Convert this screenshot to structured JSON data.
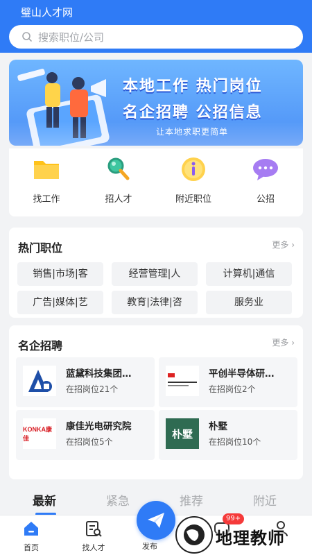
{
  "header": {
    "app_title": "璧山人才网",
    "search_placeholder": "搜索职位/公司"
  },
  "banner": {
    "line1": "本地工作  热门岗位",
    "line2": "名企招聘  公招信息",
    "sub": "让本地求职更简单"
  },
  "quick_links": [
    {
      "label": "找工作",
      "icon": "folder-icon"
    },
    {
      "label": "招人才",
      "icon": "magnifier-icon"
    },
    {
      "label": "附近职位",
      "icon": "info-icon"
    },
    {
      "label": "公招",
      "icon": "chat-bubble-icon"
    }
  ],
  "hot_jobs": {
    "title": "热门职位",
    "more": "更多",
    "tags": [
      "销售|市场|客",
      "经营管理|人",
      "计算机|通信",
      "广告|媒体|艺",
      "教育|法律|咨",
      "服务业"
    ]
  },
  "famous_companies": {
    "title": "名企招聘",
    "more": "更多",
    "items": [
      {
        "name": "蓝黛科技集团…",
        "jobs": "在招岗位21个"
      },
      {
        "name": "平创半导体研…",
        "jobs": "在招岗位2个"
      },
      {
        "name": "康佳光电研究院",
        "jobs": "在招岗位5个",
        "logo_text": "KONKA康佳"
      },
      {
        "name": "朴墅",
        "jobs": "在招岗位10个",
        "logo_text": "朴墅"
      }
    ]
  },
  "feed_tabs": [
    "最新",
    "紧急",
    "推荐",
    "附近"
  ],
  "bottom_nav": {
    "home": "首页",
    "find_talent": "找人才",
    "publish": "发布",
    "badge": "99+"
  },
  "watermark": {
    "text": "地理教师"
  },
  "colors": {
    "primary": "#2f7bf6",
    "badge": "#f53a3a"
  }
}
